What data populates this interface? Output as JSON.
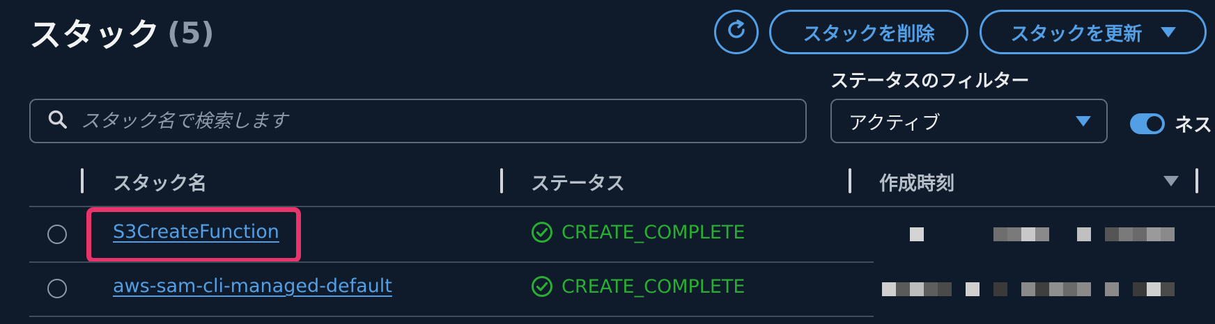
{
  "header": {
    "title": "スタック",
    "count": "(5)",
    "delete_label": "スタックを削除",
    "update_label": "スタックを更新"
  },
  "filter": {
    "status_label": "ステータスのフィルター",
    "status_value": "アクティブ"
  },
  "search": {
    "placeholder": "スタック名で検索します"
  },
  "toggle": {
    "label": "ネス",
    "enabled": true
  },
  "table": {
    "columns": [
      "スタック名",
      "ステータス",
      "作成時刻"
    ],
    "rows": [
      {
        "name": "S3CreateFunction",
        "status": "CREATE_COMPLETE",
        "created": ""
      },
      {
        "name": "aws-sam-cli-managed-default",
        "status": "CREATE_COMPLETE",
        "created": ""
      }
    ]
  },
  "colors": {
    "background": "#0f1b2a",
    "accent": "#539fe5",
    "success": "#29ad32",
    "highlight": "#e8336b"
  }
}
